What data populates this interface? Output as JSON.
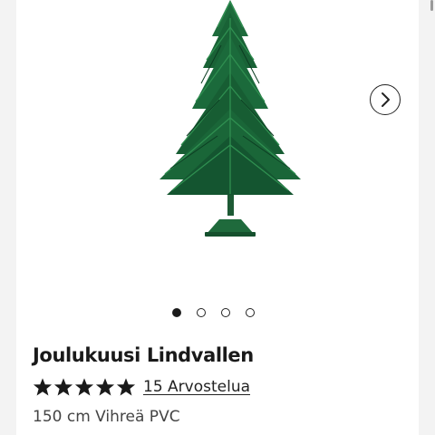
{
  "product": {
    "title": "Joulukuusi Lindvallen",
    "rating": 5,
    "rating_max": 5,
    "reviews_label": "15 Arvostelua",
    "variant": "150 cm Vihreä PVC"
  },
  "gallery": {
    "image_name": "christmas-tree-image",
    "total_images": 4,
    "active_index": 0,
    "next_icon": "chevron-right-icon"
  },
  "colors": {
    "background": "#f3f3f3",
    "card": "#ffffff",
    "text": "#1a1a1a",
    "tree_dark": "#0f4a2a",
    "tree_light": "#2e8a4c"
  }
}
